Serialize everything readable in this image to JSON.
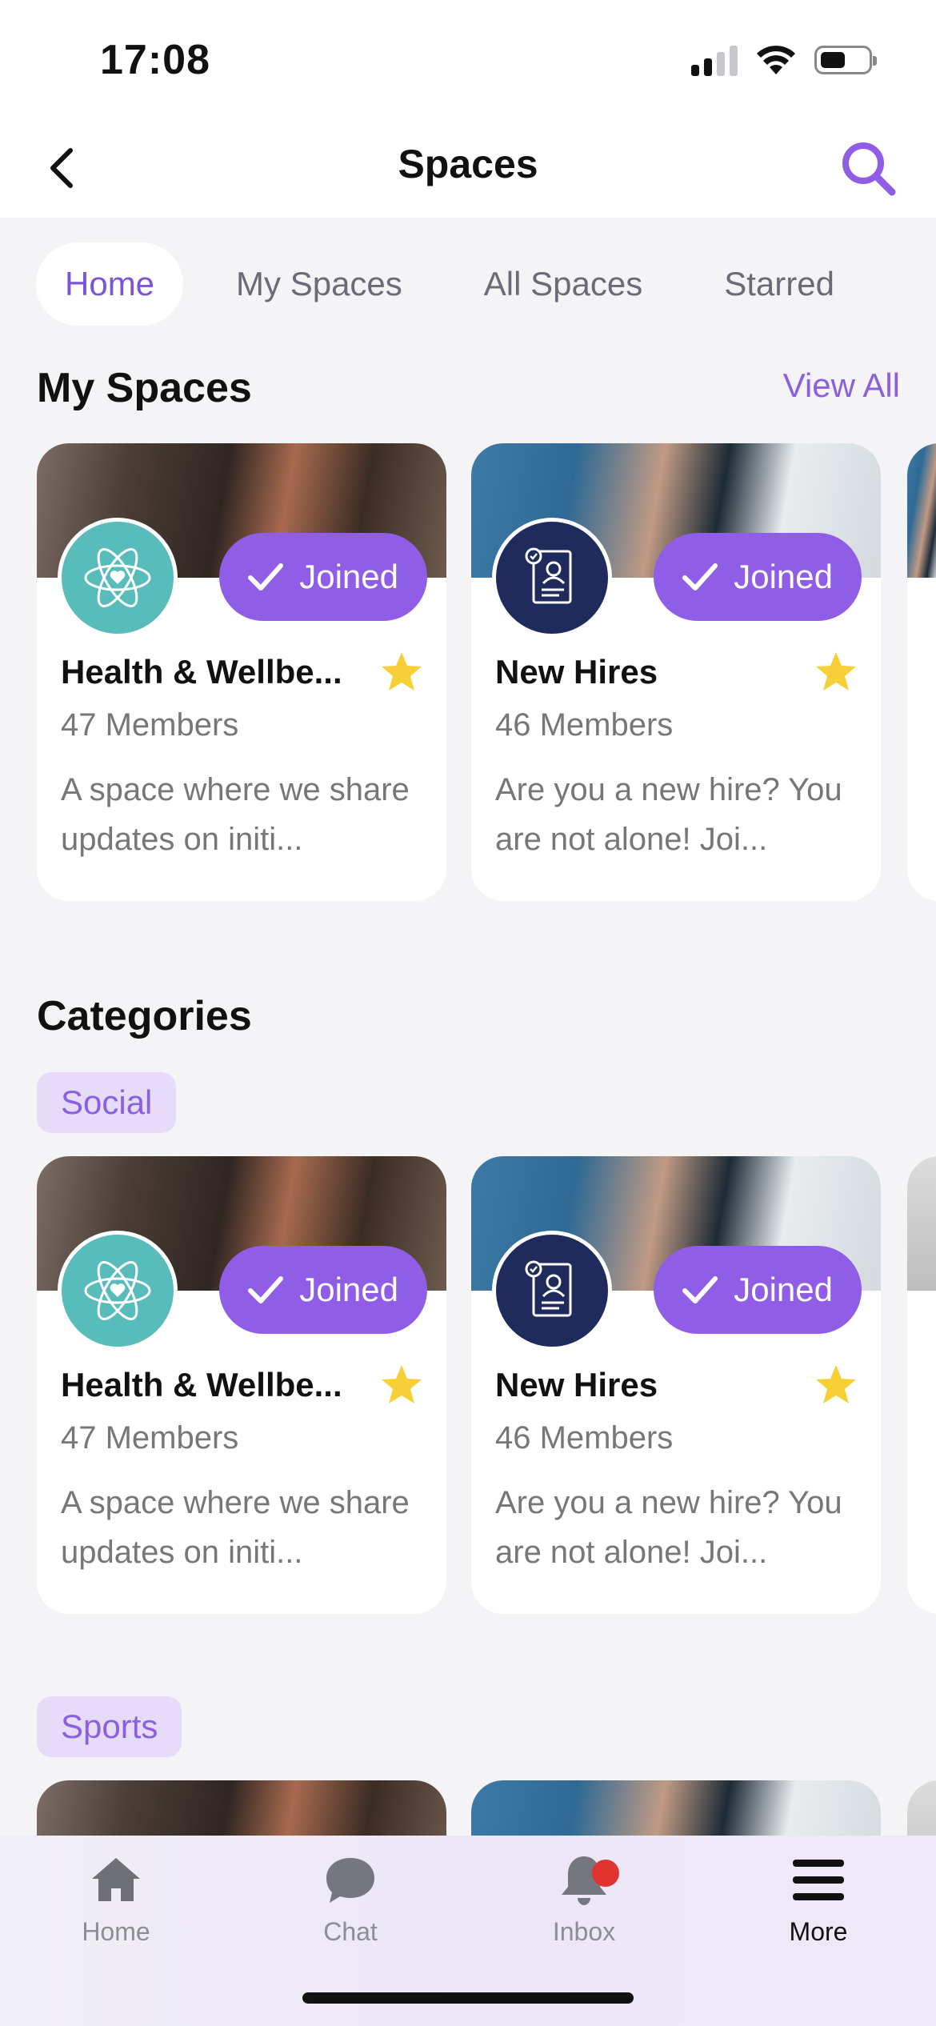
{
  "status_bar": {
    "time": "17:08"
  },
  "nav": {
    "title": "Spaces"
  },
  "tabs": [
    {
      "label": "Home",
      "active": true
    },
    {
      "label": "My Spaces",
      "active": false
    },
    {
      "label": "All Spaces",
      "active": false
    },
    {
      "label": "Starred",
      "active": false
    }
  ],
  "my_spaces": {
    "title": "My Spaces",
    "view_all": "View All",
    "cards": [
      {
        "name": "Health & Wellbe...",
        "members": "47 Members",
        "description": "A space where we share updates on initi...",
        "joined_label": "Joined",
        "starred": true
      },
      {
        "name": "New Hires",
        "members": "46 Members",
        "description": "Are you a new hire? You are not alone! Joi...",
        "joined_label": "Joined",
        "starred": true
      }
    ]
  },
  "categories": {
    "title": "Categories",
    "groups": [
      {
        "label": "Social",
        "cards": [
          {
            "name": "Health & Wellbe...",
            "members": "47 Members",
            "description": "A space where we share updates on initi...",
            "joined_label": "Joined",
            "starred": true
          },
          {
            "name": "New Hires",
            "members": "46 Members",
            "description": "Are you a new hire? You are not alone! Joi...",
            "joined_label": "Joined",
            "starred": true
          }
        ]
      },
      {
        "label": "Sports"
      }
    ]
  },
  "bottom_nav": [
    {
      "label": "Home",
      "icon": "home-icon"
    },
    {
      "label": "Chat",
      "icon": "chat-icon"
    },
    {
      "label": "Inbox",
      "icon": "bell-icon",
      "badge": true
    },
    {
      "label": "More",
      "icon": "menu-icon",
      "active": true
    }
  ],
  "colors": {
    "accent": "#8f5de6",
    "accent_text": "#7b54d9",
    "teal": "#58bcbb",
    "navy": "#1e2b5c",
    "star": "#f7d038",
    "badge": "#e0322f"
  }
}
